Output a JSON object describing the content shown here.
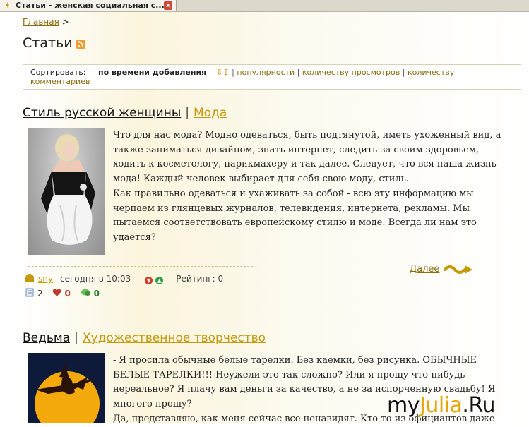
{
  "browser": {
    "tab_title": "Статьи - женская социальная с...",
    "tab_close_label": "x"
  },
  "breadcrumb": {
    "home": "Главная",
    "separator": ">"
  },
  "page": {
    "title": "Статьи"
  },
  "sort": {
    "label": "Сортировать:",
    "current": "по времени добавления",
    "arrows": "⇩⇧",
    "options": [
      "популярности",
      "количеству просмотров",
      "количеству комментариев"
    ]
  },
  "articles": [
    {
      "title": "Стиль русской женщины",
      "category": "Мода",
      "paragraphs": [
        "Что для нас мода? Модно одеваться, быть подтянутой, иметь ухоженный вид, а также заниматься дизайном, знать интернет, следить за своим здоровьем, ходить к косметологу, парикмахеру и так далее. Следует, что вся наша жизнь - мода! Каждый человек выбирает для себя свою моду, стиль.",
        "Как правильно одеваться и ухаживать за собой - всю эту информацию мы черпаем из глянцевых журналов, телевидения, интернета, рекламы. Мы пытаемся соответствовать европейскому стилю и моде. Всегда ли нам это удается?"
      ],
      "more": "Далее",
      "author": "sny",
      "date": "сегодня в 10:03",
      "rating_label": "Рейтинг: 0",
      "stats": {
        "comments": "2",
        "likes": "0",
        "shares": "0"
      }
    },
    {
      "title": "Ведьма",
      "category": "Художественное творчество",
      "paragraphs": [
        "- Я просила обычные белые тарелки. Без каемки, без рисунка. ОБЫЧНЫЕ БЕЛЫЕ ТАРЕЛКИ!!! Неужели это так сложно? Или я прошу что-нибудь нереальное? Я плачу вам деньги за качество, а не за испорченную свадьбу! Я многого прошу?",
        "Да, представляю, как меня сейчас все ненавидят. Кто-то из официантов даже"
      ]
    }
  ],
  "watermark": {
    "part1": "my",
    "part2": "Julia",
    "part3": ".Ru"
  },
  "colors": {
    "link": "#8a6d10",
    "accent": "#c49a0a",
    "rss": "#f19b2c"
  }
}
